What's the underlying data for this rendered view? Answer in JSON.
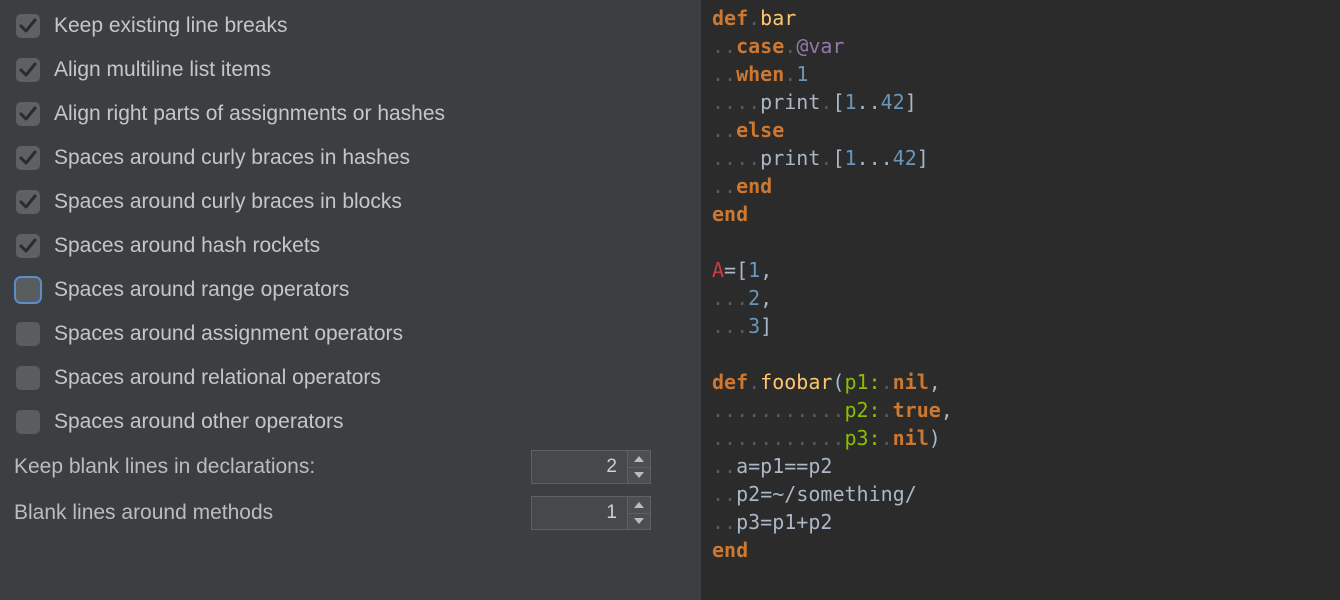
{
  "checkboxes": [
    {
      "label": "Keep existing line breaks",
      "checked": true,
      "focused": false
    },
    {
      "label": "Align multiline list items",
      "checked": true,
      "focused": false
    },
    {
      "label": "Align right parts of assignments or hashes",
      "checked": true,
      "focused": false
    },
    {
      "label": "Spaces around curly braces in hashes",
      "checked": true,
      "focused": false
    },
    {
      "label": "Spaces around curly braces in blocks",
      "checked": true,
      "focused": false
    },
    {
      "label": "Spaces around hash rockets",
      "checked": true,
      "focused": false
    },
    {
      "label": "Spaces around range operators",
      "checked": false,
      "focused": true
    },
    {
      "label": "Spaces around assignment operators",
      "checked": false,
      "focused": false
    },
    {
      "label": "Spaces around relational operators",
      "checked": false,
      "focused": false
    },
    {
      "label": "Spaces around other operators",
      "checked": false,
      "focused": false
    }
  ],
  "spinners": [
    {
      "label": "Keep blank lines in declarations:",
      "value": "2"
    },
    {
      "label": "Blank lines around methods",
      "value": "1"
    }
  ],
  "code": {
    "l1": {
      "kw": "def",
      "sp": ".",
      "name": "bar"
    },
    "l2": {
      "dots": "..",
      "kw": "case",
      "sp": ".",
      "ivar": "@var"
    },
    "l3": {
      "dots": "..",
      "kw": "when",
      "sp": ".",
      "num": "1"
    },
    "l4": {
      "dots": "....",
      "call": "print",
      "sp": ".",
      "lb": "[",
      "n1": "1",
      "range": "..",
      "n2": "42",
      "rb": "]"
    },
    "l5": {
      "dots": "..",
      "kw": "else"
    },
    "l6": {
      "dots": "....",
      "call": "print",
      "sp": ".",
      "lb": "[",
      "n1": "1",
      "range": "...",
      "n2": "42",
      "rb": "]"
    },
    "l7": {
      "dots": "..",
      "kw": "end"
    },
    "l8": {
      "kw": "end"
    },
    "blank1": "",
    "l10": {
      "const": "A",
      "eq": "=",
      "lb": "[",
      "n1": "1",
      "comma": ","
    },
    "l11": {
      "dots": "...",
      "n": "2",
      "comma": ","
    },
    "l12": {
      "dots": "...",
      "n": "3",
      "rb": "]"
    },
    "blank2": "",
    "l14": {
      "kw": "def",
      "sp": ".",
      "name": "foobar",
      "lp": "(",
      "k1": "p1:",
      "spk": ".",
      "v1": "nil",
      "comma": ","
    },
    "l15": {
      "dots": "...........",
      "k": "p2:",
      "sp": ".",
      "v": "true",
      "comma": ","
    },
    "l16": {
      "dots": "...........",
      "k": "p3:",
      "sp": ".",
      "v": "nil",
      "rp": ")"
    },
    "l17": {
      "dots": "..",
      "txt": "a=p1==p2"
    },
    "l18": {
      "dots": "..",
      "lhs": "p2",
      "eq": "=~",
      "regex": "/something/"
    },
    "l19": {
      "dots": "..",
      "txt": "p3=p1+p2"
    },
    "l20": {
      "kw": "end"
    }
  }
}
